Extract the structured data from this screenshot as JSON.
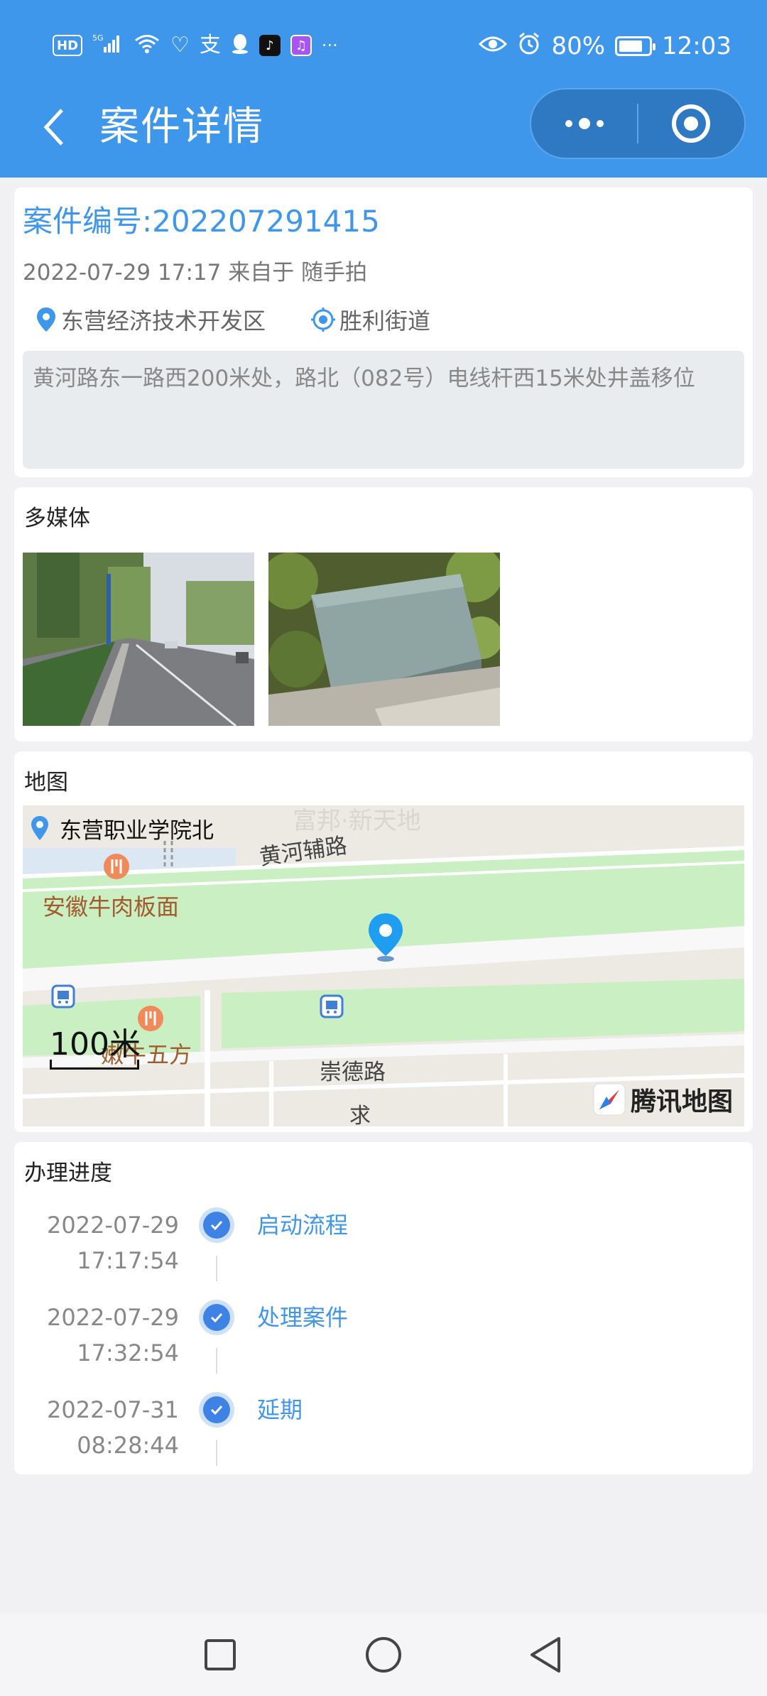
{
  "status_bar": {
    "left_chips": [
      "HD",
      "5G"
    ],
    "battery_percent": "80%",
    "battery_level": 0.8,
    "time": "12:03",
    "more": "···"
  },
  "header": {
    "title": "案件详情"
  },
  "case": {
    "number_label": "案件编号:202207291415",
    "meta": "2022-07-29 17:17 来自于 随手拍",
    "district": "东营经济技术开发区",
    "street": "胜利街道",
    "description": "黄河路东一路西200米处，路北（082号）电线杆西15米处井盖移位"
  },
  "media": {
    "title": "多媒体"
  },
  "map": {
    "title": "地图",
    "place": "东营职业学院北",
    "labels": {
      "poi_top": "富邦·新天地",
      "restaurant_1": "安徽牛肉板面",
      "road_1": "黄河辅路",
      "restaurant_2": "嫩牛五方",
      "road_2": "崇德路",
      "bottom": "求"
    },
    "scale": "100米",
    "brand": "腾讯地图"
  },
  "progress": {
    "title": "办理进度",
    "steps": [
      {
        "date": "2022-07-29",
        "time": "17:17:54",
        "label": "启动流程"
      },
      {
        "date": "2022-07-29",
        "time": "17:32:54",
        "label": "处理案件"
      },
      {
        "date": "2022-07-31",
        "time": "08:28:44",
        "label": "延期"
      }
    ]
  },
  "colors": {
    "primary": "#3f97ec",
    "header_bg": "#3f97ec",
    "page_bg": "#f1f1f3",
    "step_dot": "#3f82e6"
  },
  "icons": {
    "back": "chevron-left-icon",
    "menu": "more-dots-icon",
    "close": "target-circle-icon",
    "district": "map-pin-icon",
    "street": "location-target-icon",
    "check": "check-icon"
  }
}
